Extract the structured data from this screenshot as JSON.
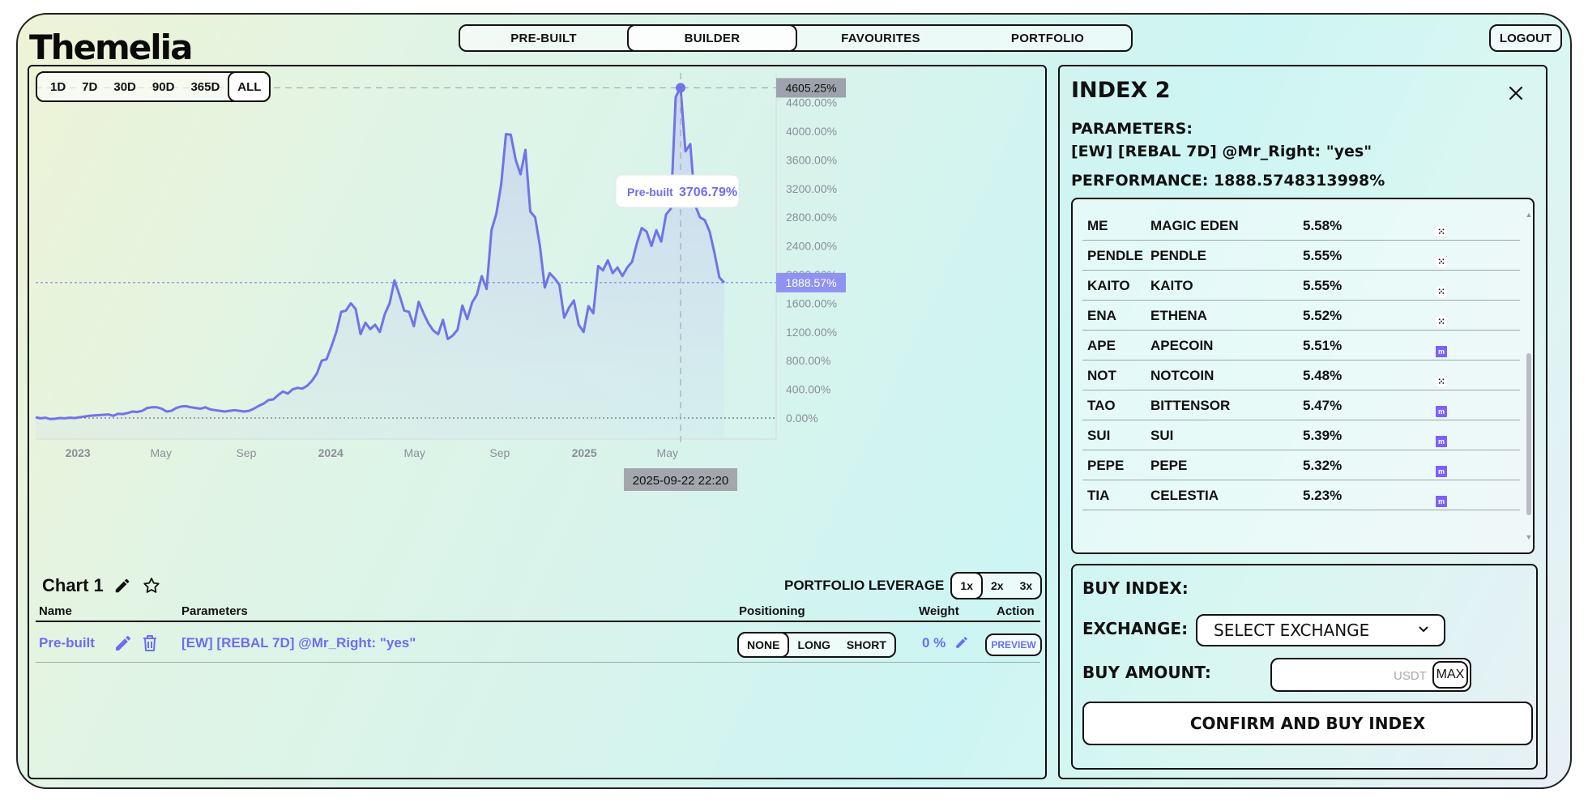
{
  "brand": "Themelia",
  "nav": {
    "tabs": [
      "PRE-BUILT",
      "BUILDER",
      "FAVOURITES",
      "PORTFOLIO"
    ],
    "active": "BUILDER",
    "logout": "LOGOUT"
  },
  "range": {
    "buttons": [
      "1D",
      "7D",
      "30D",
      "90D",
      "365D",
      "ALL"
    ],
    "active": "ALL"
  },
  "chart_data": {
    "type": "line",
    "series": [
      {
        "name": "Pre-built"
      }
    ],
    "y_ticks": [
      "0.00%",
      "400.00%",
      "800.00%",
      "1200.00%",
      "1600.00%",
      "2000.00%",
      "2400.00%",
      "2800.00%",
      "3200.00%",
      "3600.00%",
      "4000.00%",
      "4400.00%"
    ],
    "ylim": [
      -300,
      4850
    ],
    "x_ticks": [
      {
        "label": "2023",
        "bold": true
      },
      {
        "label": "May",
        "bold": false
      },
      {
        "label": "Sep",
        "bold": false
      },
      {
        "label": "2024",
        "bold": true
      },
      {
        "label": "May",
        "bold": false
      },
      {
        "label": "Sep",
        "bold": false
      },
      {
        "label": "2025",
        "bold": true
      },
      {
        "label": "May",
        "bold": false
      }
    ],
    "x_start": "2022-11-01",
    "x_end": "2025-10-05",
    "points": [
      [
        "2022-11-01",
        10
      ],
      [
        "2022-11-08",
        -5
      ],
      [
        "2022-11-15",
        5
      ],
      [
        "2022-11-22",
        -15
      ],
      [
        "2022-11-29",
        -10
      ],
      [
        "2022-12-06",
        0
      ],
      [
        "2022-12-13",
        -5
      ],
      [
        "2022-12-20",
        5
      ],
      [
        "2022-12-27",
        0
      ],
      [
        "2023-01-03",
        10
      ],
      [
        "2023-01-10",
        20
      ],
      [
        "2023-01-17",
        30
      ],
      [
        "2023-01-24",
        35
      ],
      [
        "2023-01-31",
        40
      ],
      [
        "2023-02-07",
        45
      ],
      [
        "2023-02-14",
        50
      ],
      [
        "2023-02-21",
        30
      ],
      [
        "2023-02-28",
        60
      ],
      [
        "2023-03-07",
        55
      ],
      [
        "2023-03-14",
        70
      ],
      [
        "2023-03-21",
        90
      ],
      [
        "2023-03-28",
        85
      ],
      [
        "2023-04-04",
        100
      ],
      [
        "2023-04-11",
        140
      ],
      [
        "2023-04-18",
        150
      ],
      [
        "2023-04-25",
        150
      ],
      [
        "2023-05-02",
        130
      ],
      [
        "2023-05-09",
        90
      ],
      [
        "2023-05-16",
        100
      ],
      [
        "2023-05-23",
        140
      ],
      [
        "2023-05-30",
        160
      ],
      [
        "2023-06-06",
        165
      ],
      [
        "2023-06-13",
        150
      ],
      [
        "2023-06-20",
        140
      ],
      [
        "2023-06-27",
        130
      ],
      [
        "2023-07-04",
        150
      ],
      [
        "2023-07-11",
        120
      ],
      [
        "2023-07-18",
        110
      ],
      [
        "2023-07-25",
        100
      ],
      [
        "2023-08-01",
        90
      ],
      [
        "2023-08-08",
        100
      ],
      [
        "2023-08-15",
        110
      ],
      [
        "2023-08-22",
        100
      ],
      [
        "2023-08-29",
        90
      ],
      [
        "2023-09-05",
        100
      ],
      [
        "2023-09-12",
        130
      ],
      [
        "2023-09-19",
        170
      ],
      [
        "2023-09-26",
        200
      ],
      [
        "2023-10-03",
        250
      ],
      [
        "2023-10-10",
        260
      ],
      [
        "2023-10-17",
        320
      ],
      [
        "2023-10-24",
        370
      ],
      [
        "2023-10-31",
        340
      ],
      [
        "2023-11-07",
        400
      ],
      [
        "2023-11-14",
        420
      ],
      [
        "2023-11-21",
        410
      ],
      [
        "2023-11-28",
        450
      ],
      [
        "2023-12-05",
        520
      ],
      [
        "2023-12-12",
        620
      ],
      [
        "2023-12-19",
        800
      ],
      [
        "2023-12-26",
        820
      ],
      [
        "2024-01-02",
        1000
      ],
      [
        "2024-01-09",
        1200
      ],
      [
        "2024-01-16",
        1480
      ],
      [
        "2024-01-23",
        1500
      ],
      [
        "2024-01-30",
        1600
      ],
      [
        "2024-02-06",
        1520
      ],
      [
        "2024-02-13",
        1170
      ],
      [
        "2024-02-20",
        1330
      ],
      [
        "2024-02-27",
        1240
      ],
      [
        "2024-03-05",
        1300
      ],
      [
        "2024-03-12",
        1200
      ],
      [
        "2024-03-19",
        1450
      ],
      [
        "2024-03-26",
        1600
      ],
      [
        "2024-04-02",
        1920
      ],
      [
        "2024-04-09",
        1720
      ],
      [
        "2024-04-16",
        1500
      ],
      [
        "2024-04-23",
        1480
      ],
      [
        "2024-04-30",
        1280
      ],
      [
        "2024-05-07",
        1620
      ],
      [
        "2024-05-14",
        1460
      ],
      [
        "2024-05-21",
        1320
      ],
      [
        "2024-05-28",
        1220
      ],
      [
        "2024-06-04",
        1170
      ],
      [
        "2024-06-11",
        1370
      ],
      [
        "2024-06-18",
        1100
      ],
      [
        "2024-06-25",
        1150
      ],
      [
        "2024-07-02",
        1230
      ],
      [
        "2024-07-09",
        1570
      ],
      [
        "2024-07-16",
        1380
      ],
      [
        "2024-07-23",
        1610
      ],
      [
        "2024-07-30",
        1720
      ],
      [
        "2024-08-06",
        1980
      ],
      [
        "2024-08-13",
        1800
      ],
      [
        "2024-08-20",
        2620
      ],
      [
        "2024-08-27",
        2850
      ],
      [
        "2024-09-03",
        3260
      ],
      [
        "2024-09-10",
        3960
      ],
      [
        "2024-09-17",
        3950
      ],
      [
        "2024-09-24",
        3600
      ],
      [
        "2024-10-01",
        3400
      ],
      [
        "2024-10-08",
        3740
      ],
      [
        "2024-10-15",
        2880
      ],
      [
        "2024-10-22",
        2800
      ],
      [
        "2024-10-29",
        2400
      ],
      [
        "2024-11-05",
        1820
      ],
      [
        "2024-11-12",
        2020
      ],
      [
        "2024-11-19",
        1950
      ],
      [
        "2024-11-26",
        1860
      ],
      [
        "2024-12-03",
        1400
      ],
      [
        "2024-12-10",
        1540
      ],
      [
        "2024-12-17",
        1640
      ],
      [
        "2024-12-24",
        1300
      ],
      [
        "2024-12-31",
        1200
      ],
      [
        "2025-01-07",
        1560
      ],
      [
        "2025-01-14",
        1460
      ],
      [
        "2025-01-21",
        2120
      ],
      [
        "2025-01-28",
        2060
      ],
      [
        "2025-02-04",
        2200
      ],
      [
        "2025-02-11",
        2020
      ],
      [
        "2025-02-18",
        2100
      ],
      [
        "2025-02-25",
        1980
      ],
      [
        "2025-03-04",
        2100
      ],
      [
        "2025-03-11",
        2180
      ],
      [
        "2025-03-18",
        2440
      ],
      [
        "2025-03-25",
        2650
      ],
      [
        "2025-04-01",
        2600
      ],
      [
        "2025-04-08",
        2400
      ],
      [
        "2025-04-15",
        2620
      ],
      [
        "2025-04-22",
        2460
      ],
      [
        "2025-04-29",
        2840
      ],
      [
        "2025-05-06",
        2920
      ],
      [
        "2025-05-13",
        4480
      ],
      [
        "2025-05-20",
        4605.25
      ],
      [
        "2025-05-27",
        3720
      ],
      [
        "2025-06-03",
        3820
      ],
      [
        "2025-06-10",
        2970
      ],
      [
        "2025-06-17",
        2800
      ],
      [
        "2025-06-24",
        2760
      ],
      [
        "2025-07-01",
        2600
      ],
      [
        "2025-07-08",
        2300
      ],
      [
        "2025-07-15",
        1960
      ],
      [
        "2025-07-22",
        1888.57
      ]
    ],
    "peak_label": "4605.25%",
    "current_label": "1888.57%",
    "current_value": 1888.57,
    "crosshair_date": "2025-09-22 22:20",
    "tooltip": {
      "series": "Pre-built",
      "value": "3706.79%"
    }
  },
  "chart_panel": {
    "title": "Chart 1",
    "leverage_label": "PORTFOLIO LEVERAGE",
    "leverage_options": [
      "1x",
      "2x",
      "3x"
    ],
    "leverage_active": "1x",
    "columns": {
      "name": "Name",
      "parameters": "Parameters",
      "positioning": "Positioning",
      "weight": "Weight",
      "action": "Action"
    },
    "row": {
      "name": "Pre-built",
      "parameters": "[EW] [REBAL 7D] @Mr_Right: \"yes\"",
      "positioning": [
        "NONE",
        "LONG",
        "SHORT"
      ],
      "positioning_active": "NONE",
      "weight": "0 %",
      "action": "PREVIEW"
    }
  },
  "index": {
    "title": "INDEX 2",
    "params_label": "PARAMETERS:",
    "params_value": "[EW] [REBAL 7D] @Mr_Right: \"yes\"",
    "performance": "PERFORMANCE: 1888.5748313998%",
    "holdings": [
      {
        "ticker": "ME",
        "name": "MAGIC EDEN",
        "weight": "5.58%",
        "exchanges": [
          "binance",
          "bybit",
          "coinbase",
          "kraken",
          "okx"
        ]
      },
      {
        "ticker": "PENDLE",
        "name": "PENDLE",
        "weight": "5.55%",
        "exchanges": [
          "binance",
          "bybit",
          "coinbase",
          "kraken",
          "okx"
        ]
      },
      {
        "ticker": "KAITO",
        "name": "KAITO",
        "weight": "5.55%",
        "exchanges": [
          "binance",
          "coinbase",
          "kraken",
          "okx"
        ]
      },
      {
        "ticker": "ENA",
        "name": "ETHENA",
        "weight": "5.52%",
        "exchanges": [
          "binance",
          "bybit",
          "coinbase",
          "kraken",
          "okx"
        ]
      },
      {
        "ticker": "APE",
        "name": "APECOIN",
        "weight": "5.51%",
        "exchanges": [
          "binance",
          "bybit",
          "coinbase",
          "x",
          "kraken"
        ]
      },
      {
        "ticker": "NOT",
        "name": "NOTCOIN",
        "weight": "5.48%",
        "exchanges": [
          "binance",
          "bybit",
          "kraken",
          "okx"
        ]
      },
      {
        "ticker": "TAO",
        "name": "BITTENSOR",
        "weight": "5.47%",
        "exchanges": [
          "binance",
          "coinbase",
          "kraken"
        ]
      },
      {
        "ticker": "SUI",
        "name": "SUI",
        "weight": "5.39%",
        "exchanges": [
          "binance",
          "bybit",
          "coinbase",
          "x",
          "kraken"
        ]
      },
      {
        "ticker": "PEPE",
        "name": "PEPE",
        "weight": "5.32%",
        "exchanges": [
          "binance",
          "bybit",
          "coinbase",
          "x",
          "kraken"
        ]
      },
      {
        "ticker": "TIA",
        "name": "CELESTIA",
        "weight": "5.23%",
        "exchanges": [
          "binance",
          "bybit",
          "coinbase",
          "x",
          "kraken"
        ]
      }
    ]
  },
  "buy": {
    "title": "BUY INDEX:",
    "exchange_label": "EXCHANGE:",
    "exchange_value": "SELECT EXCHANGE",
    "amount_label": "BUY AMOUNT:",
    "amount_value": "",
    "currency": "USDT",
    "max": "MAX",
    "confirm": "CONFIRM AND BUY INDEX"
  },
  "colors": {
    "accent": "#6b6ef0",
    "line": "#7173e8",
    "peak_bg": "#9da2ad",
    "current_bg": "#8f92f0",
    "date_bg": "#a3a6ad"
  }
}
